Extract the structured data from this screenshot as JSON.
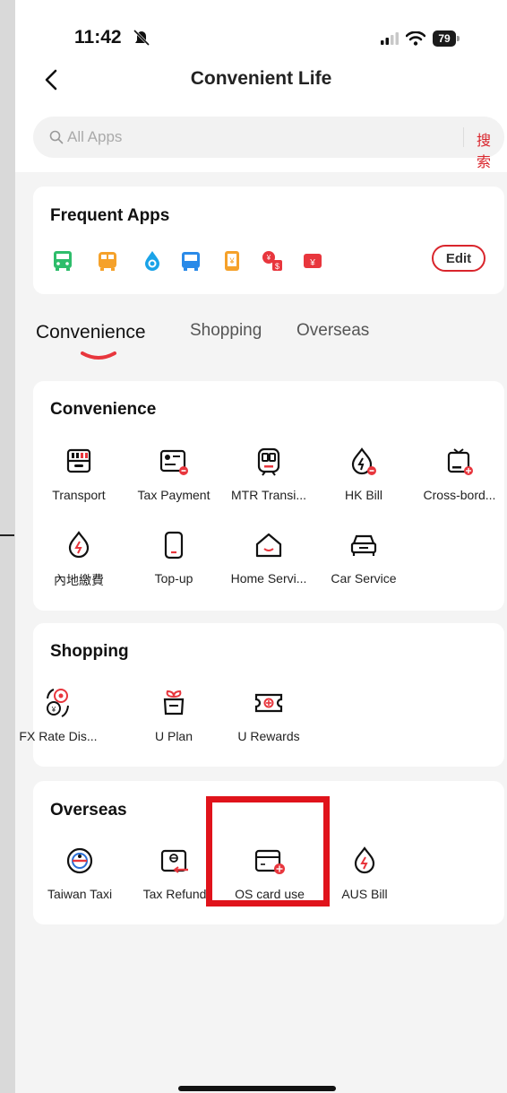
{
  "status": {
    "time": "11:42",
    "battery": "79"
  },
  "header": {
    "title": "Convenient Life"
  },
  "search": {
    "placeholder": "All Apps",
    "button": "搜索"
  },
  "frequent": {
    "title": "Frequent Apps",
    "edit": "Edit",
    "icons": [
      "bus-icon",
      "minibus-icon",
      "water-drop-icon",
      "tram-icon",
      "mobile-topup-icon",
      "currency-exchange-icon",
      "red-packet-icon"
    ]
  },
  "tabs": [
    "Convenience",
    "Shopping",
    "Overseas"
  ],
  "convenience": {
    "title": "Convenience",
    "items": [
      {
        "label": "Transport",
        "icon": "transport-icon"
      },
      {
        "label": "Tax Payment",
        "icon": "tax-payment-icon"
      },
      {
        "label": "MTR Transi...",
        "icon": "mtr-train-icon"
      },
      {
        "label": "HK Bill",
        "icon": "hk-bill-icon"
      },
      {
        "label": "Cross-bord...",
        "icon": "cross-border-icon"
      },
      {
        "label": "內地繳費",
        "icon": "mainland-bill-icon"
      },
      {
        "label": "Top-up",
        "icon": "top-up-icon"
      },
      {
        "label": "Home Servi...",
        "icon": "home-service-icon"
      },
      {
        "label": "Car Service",
        "icon": "car-service-icon"
      }
    ]
  },
  "shopping": {
    "title": "Shopping",
    "items": [
      {
        "label": "FX Rate Dis...",
        "icon": "fx-rate-icon"
      },
      {
        "label": "U Plan",
        "icon": "gift-icon"
      },
      {
        "label": "U Rewards",
        "icon": "rewards-icon"
      }
    ]
  },
  "overseas": {
    "title": "Overseas",
    "items": [
      {
        "label": "Taiwan Taxi",
        "icon": "taiwan-taxi-icon"
      },
      {
        "label": "Tax Refund",
        "icon": "tax-refund-icon"
      },
      {
        "label": "OS card use",
        "icon": "os-card-icon"
      },
      {
        "label": "AUS Bill",
        "icon": "aus-bill-icon"
      }
    ]
  },
  "colors": {
    "accent": "#d9252c",
    "highlight": "#e0131b"
  }
}
